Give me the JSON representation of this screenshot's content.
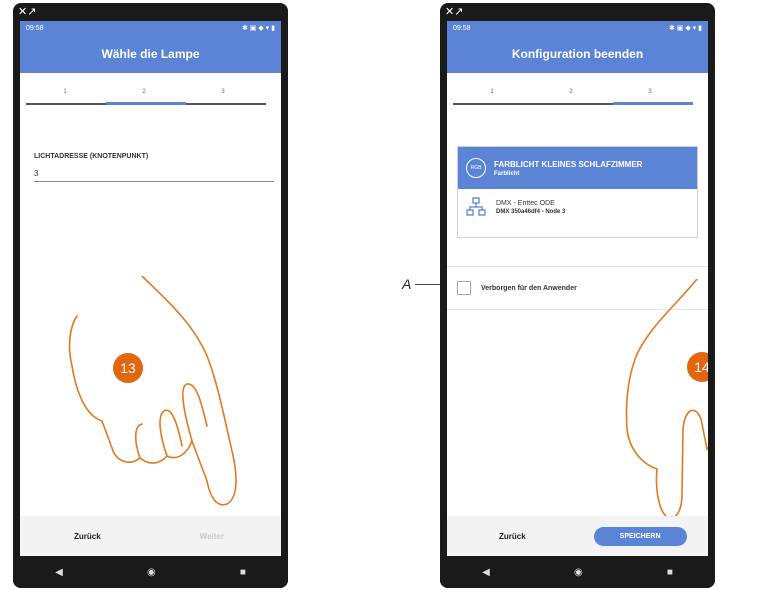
{
  "left_phone": {
    "status_time": "09:58",
    "title": "Wähle die Lampe",
    "steps": [
      "1",
      "2",
      "3"
    ],
    "field_label": "LICHTADRESSE (KNOTENPUNKT)",
    "field_value": "3",
    "back_label": "Zurück",
    "next_label": "Weiter",
    "step_badge": "13"
  },
  "right_phone": {
    "status_time": "09:58",
    "title": "Konfiguration beenden",
    "steps": [
      "1",
      "2",
      "3"
    ],
    "rgb_icon_text": "RGB",
    "card_title": "FARBLICHT KLEINES SCHLAFZIMMER",
    "card_subtitle": "Farblicht",
    "device_name": "DMX - Enttec ODE",
    "device_id": "DMX 350a46df4 - Node 3",
    "hidden_label": "Verborgen für den Anwender",
    "back_label": "Zurück",
    "save_label": "SPEICHERN",
    "step_badge": "14"
  },
  "callout": "A",
  "colors": {
    "accent": "#5b84d6",
    "badge": "#e2650f",
    "hand": "#e07a1f"
  }
}
